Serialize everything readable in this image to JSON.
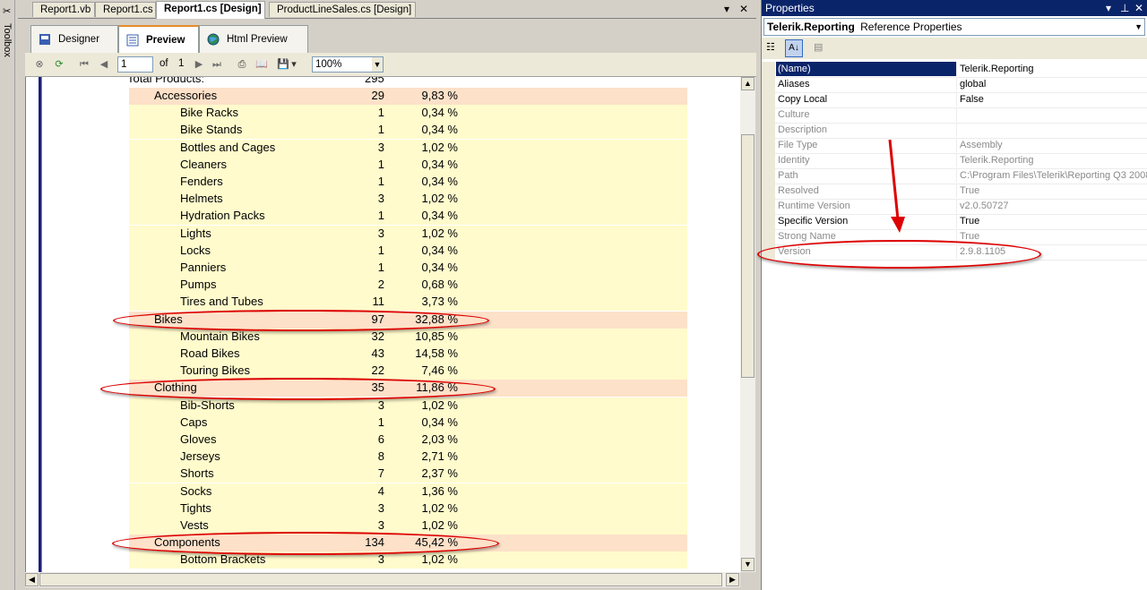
{
  "toolbox": {
    "label": "Toolbox"
  },
  "doc_tabs": [
    {
      "label": "Report1.vb"
    },
    {
      "label": "Report1.cs"
    },
    {
      "label": "Report1.cs [Design]"
    },
    {
      "label": "ProductLineSales.cs [Design]"
    }
  ],
  "view_tabs": [
    {
      "label": "Designer"
    },
    {
      "label": "Preview"
    },
    {
      "label": "Html Preview"
    }
  ],
  "preview_toolbar": {
    "page_value": "1",
    "of_label": "of",
    "total_pages": "1",
    "zoom": "100%"
  },
  "report": {
    "total_label": "Total Products:",
    "total_value": "295",
    "rows": [
      {
        "name": "Accessories",
        "count": "29",
        "pct": "9,83 %",
        "type": "category"
      },
      {
        "name": "Bike Racks",
        "count": "1",
        "pct": "0,34 %",
        "type": "item"
      },
      {
        "name": "Bike Stands",
        "count": "1",
        "pct": "0,34 %",
        "type": "item"
      },
      {
        "name": "Bottles and Cages",
        "count": "3",
        "pct": "1,02 %",
        "type": "item"
      },
      {
        "name": "Cleaners",
        "count": "1",
        "pct": "0,34 %",
        "type": "item"
      },
      {
        "name": "Fenders",
        "count": "1",
        "pct": "0,34 %",
        "type": "item"
      },
      {
        "name": "Helmets",
        "count": "3",
        "pct": "1,02 %",
        "type": "item"
      },
      {
        "name": "Hydration Packs",
        "count": "1",
        "pct": "0,34 %",
        "type": "item"
      },
      {
        "name": "Lights",
        "count": "3",
        "pct": "1,02 %",
        "type": "item"
      },
      {
        "name": "Locks",
        "count": "1",
        "pct": "0,34 %",
        "type": "item"
      },
      {
        "name": "Panniers",
        "count": "1",
        "pct": "0,34 %",
        "type": "item"
      },
      {
        "name": "Pumps",
        "count": "2",
        "pct": "0,68 %",
        "type": "item"
      },
      {
        "name": "Tires and Tubes",
        "count": "11",
        "pct": "3,73 %",
        "type": "item"
      },
      {
        "name": "Bikes",
        "count": "97",
        "pct": "32,88 %",
        "type": "category"
      },
      {
        "name": "Mountain Bikes",
        "count": "32",
        "pct": "10,85 %",
        "type": "item"
      },
      {
        "name": "Road Bikes",
        "count": "43",
        "pct": "14,58 %",
        "type": "item"
      },
      {
        "name": "Touring Bikes",
        "count": "22",
        "pct": "7,46 %",
        "type": "item"
      },
      {
        "name": "Clothing",
        "count": "35",
        "pct": "11,86 %",
        "type": "category"
      },
      {
        "name": "Bib-Shorts",
        "count": "3",
        "pct": "1,02 %",
        "type": "item"
      },
      {
        "name": "Caps",
        "count": "1",
        "pct": "0,34 %",
        "type": "item"
      },
      {
        "name": "Gloves",
        "count": "6",
        "pct": "2,03 %",
        "type": "item"
      },
      {
        "name": "Jerseys",
        "count": "8",
        "pct": "2,71 %",
        "type": "item"
      },
      {
        "name": "Shorts",
        "count": "7",
        "pct": "2,37 %",
        "type": "item"
      },
      {
        "name": "Socks",
        "count": "4",
        "pct": "1,36 %",
        "type": "item"
      },
      {
        "name": "Tights",
        "count": "3",
        "pct": "1,02 %",
        "type": "item"
      },
      {
        "name": "Vests",
        "count": "3",
        "pct": "1,02 %",
        "type": "item"
      },
      {
        "name": "Components",
        "count": "134",
        "pct": "45,42 %",
        "type": "category"
      },
      {
        "name": "Bottom Brackets",
        "count": "3",
        "pct": "1,02 %",
        "type": "item"
      }
    ]
  },
  "properties": {
    "title": "Properties",
    "object_name": "Telerik.Reporting",
    "object_type": "Reference Properties",
    "rows": [
      {
        "name": "(Name)",
        "value": "Telerik.Reporting",
        "state": "selected"
      },
      {
        "name": "Aliases",
        "value": "global",
        "state": "normal"
      },
      {
        "name": "Copy Local",
        "value": "False",
        "state": "normal"
      },
      {
        "name": "Culture",
        "value": "",
        "state": "disabled"
      },
      {
        "name": "Description",
        "value": "",
        "state": "disabled"
      },
      {
        "name": "File Type",
        "value": "Assembly",
        "state": "disabled"
      },
      {
        "name": "Identity",
        "value": "Telerik.Reporting",
        "state": "disabled"
      },
      {
        "name": "Path",
        "value": "C:\\Program Files\\Telerik\\Reporting Q3 2008",
        "state": "disabled"
      },
      {
        "name": "Resolved",
        "value": "True",
        "state": "disabled"
      },
      {
        "name": "Runtime Version",
        "value": "v2.0.50727",
        "state": "disabled"
      },
      {
        "name": "Specific Version",
        "value": "True",
        "state": "normal"
      },
      {
        "name": "Strong Name",
        "value": "True",
        "state": "disabled"
      },
      {
        "name": "Version",
        "value": "2.9.8.1105",
        "state": "disabled"
      }
    ]
  },
  "colors": {
    "annotation": "#dd0000",
    "category_row": "#fde1c9",
    "item_row": "#fffbcc",
    "titlebar": "#0a246a"
  }
}
